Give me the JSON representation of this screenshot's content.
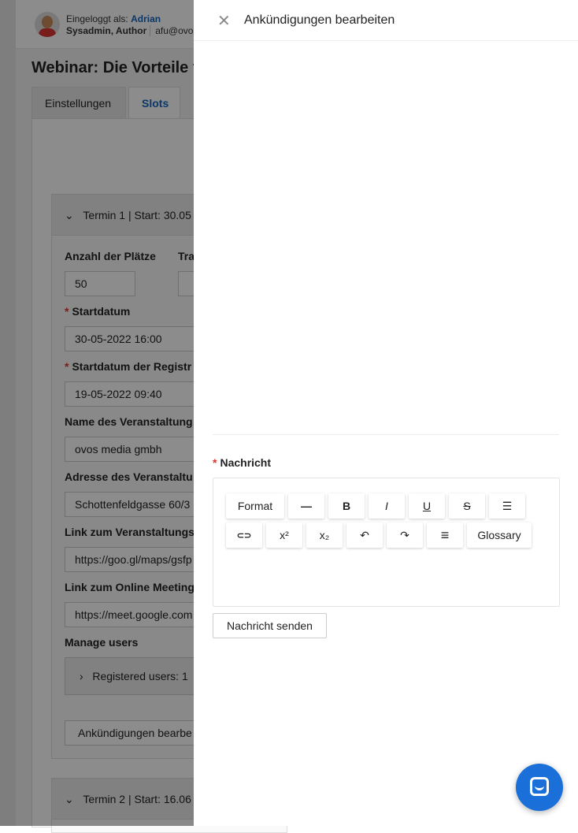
{
  "background": {
    "user": {
      "logged_in_label": "Eingeloggt als:",
      "name": "Adrian",
      "roles": "Sysadmin, Author",
      "email": "afu@ovos"
    },
    "page_title": "Webinar: Die Vorteile v",
    "tabs": [
      {
        "label": "Einstellungen"
      },
      {
        "label": "Slots",
        "active": true
      }
    ],
    "slot1": {
      "header": "Termin 1 | Start: 30.05",
      "fields": [
        {
          "label": "Anzahl der Plätze",
          "value": "50"
        },
        {
          "label": "Tra",
          "value": ""
        },
        {
          "label": "Startdatum",
          "required": true,
          "value": "30-05-2022 16:00"
        },
        {
          "label": "Startdatum der Registr",
          "required": true,
          "value": "19-05-2022 09:40"
        },
        {
          "label": "Name des Veranstaltung",
          "value": "ovos media gmbh"
        },
        {
          "label": "Adresse des Veranstaltu",
          "value": "Schottenfeldgasse 60/3"
        },
        {
          "label": "Link zum Veranstaltungs",
          "value": "https://goo.gl/maps/gsfp"
        },
        {
          "label": "Link zum Online Meeting",
          "value": "https://meet.google.com"
        }
      ],
      "manage_users_label": "Manage users",
      "registered_users": "Registered users: 1",
      "announcements_button": "Ankündigungen bearbe"
    },
    "slot2": {
      "header": "Termin 2 | Start: 16.06"
    }
  },
  "drawer": {
    "title": "Ankündigungen bearbeiten",
    "message_label": "Nachricht",
    "toolbar": {
      "format": "Format",
      "hr": "—",
      "bold": "B",
      "italic": "I",
      "underline": "U",
      "strike": "S",
      "list": "☰",
      "link": "⊂⊃",
      "sup": "x²",
      "sub": "x₂",
      "undo": "↶",
      "redo": "↷",
      "align": "≡",
      "glossary": "Glossary"
    },
    "send_button": "Nachricht senden"
  },
  "colors": {
    "accent": "#1565c0",
    "chat": "#1a6fd8",
    "required": "#dd3333"
  }
}
